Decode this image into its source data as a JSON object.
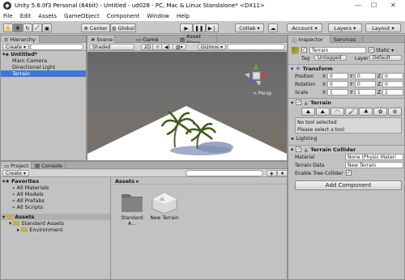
{
  "titlebar": {
    "title": "Unity 5.6.0f3 Personal (64bit) - Untitled - ud028 - PC, Mac & Linux Standalone* <DX11>",
    "minimize": "—",
    "maximize": "☐",
    "close": "✕"
  },
  "menu": [
    "File",
    "Edit",
    "Assets",
    "GameObject",
    "Component",
    "Window",
    "Help"
  ],
  "toolbar": {
    "center": "Center",
    "global": "Global",
    "collab": "Collab ▾",
    "account": "Account ▾",
    "layers": "Layers ▾",
    "layout": "Layout ▾"
  },
  "hierarchy": {
    "tab": "Hierarchy",
    "create": "Create ▾",
    "scene": "Untitled*",
    "items": [
      "Main Camera",
      "Directional Light",
      "Terrain"
    ]
  },
  "scene": {
    "tabs": [
      "Scene",
      "Game",
      "Asset Store"
    ],
    "shaded": "Shaded",
    "mode2d": "2D",
    "gizmos": "Gizmos ▾",
    "persp": "< Persp"
  },
  "project": {
    "tabs": [
      "Project",
      "Console"
    ],
    "create": "Create ▾",
    "favorites_title": "Favorites",
    "favorites": [
      "All Materials",
      "All Models",
      "All Prefabs",
      "All Scripts"
    ],
    "assets_title": "Assets",
    "tree": [
      "Standard Assets",
      "Environment"
    ],
    "breadcrumb": "Assets ▸",
    "items": [
      "Standard A...",
      "New Terrain"
    ]
  },
  "inspector": {
    "tabs": [
      "Inspector",
      "Services"
    ],
    "name": "Terrain",
    "static_label": "Static ▾",
    "tag_label": "Tag",
    "tag": "Untagged",
    "layer_label": "Layer",
    "layer": "Default",
    "transform": {
      "title": "Transform",
      "position": "Position",
      "rotation": "Rotation",
      "scale": "Scale",
      "pos": [
        "0",
        "0",
        "0"
      ],
      "rot": [
        "0",
        "0",
        "0"
      ],
      "scl": [
        "1",
        "1",
        "1"
      ]
    },
    "terrain": {
      "title": "Terrain",
      "no_tool": "No tool selected",
      "select_tool": "Please select a tool",
      "lighting": "Lighting"
    },
    "collider": {
      "title": "Terrain Collider",
      "material_label": "Material",
      "material": "None (Physic Materi",
      "data_label": "Terrain Data",
      "data": "New Terrain",
      "tree_label": "Enable Tree Collider"
    },
    "add_component": "Add Component"
  }
}
